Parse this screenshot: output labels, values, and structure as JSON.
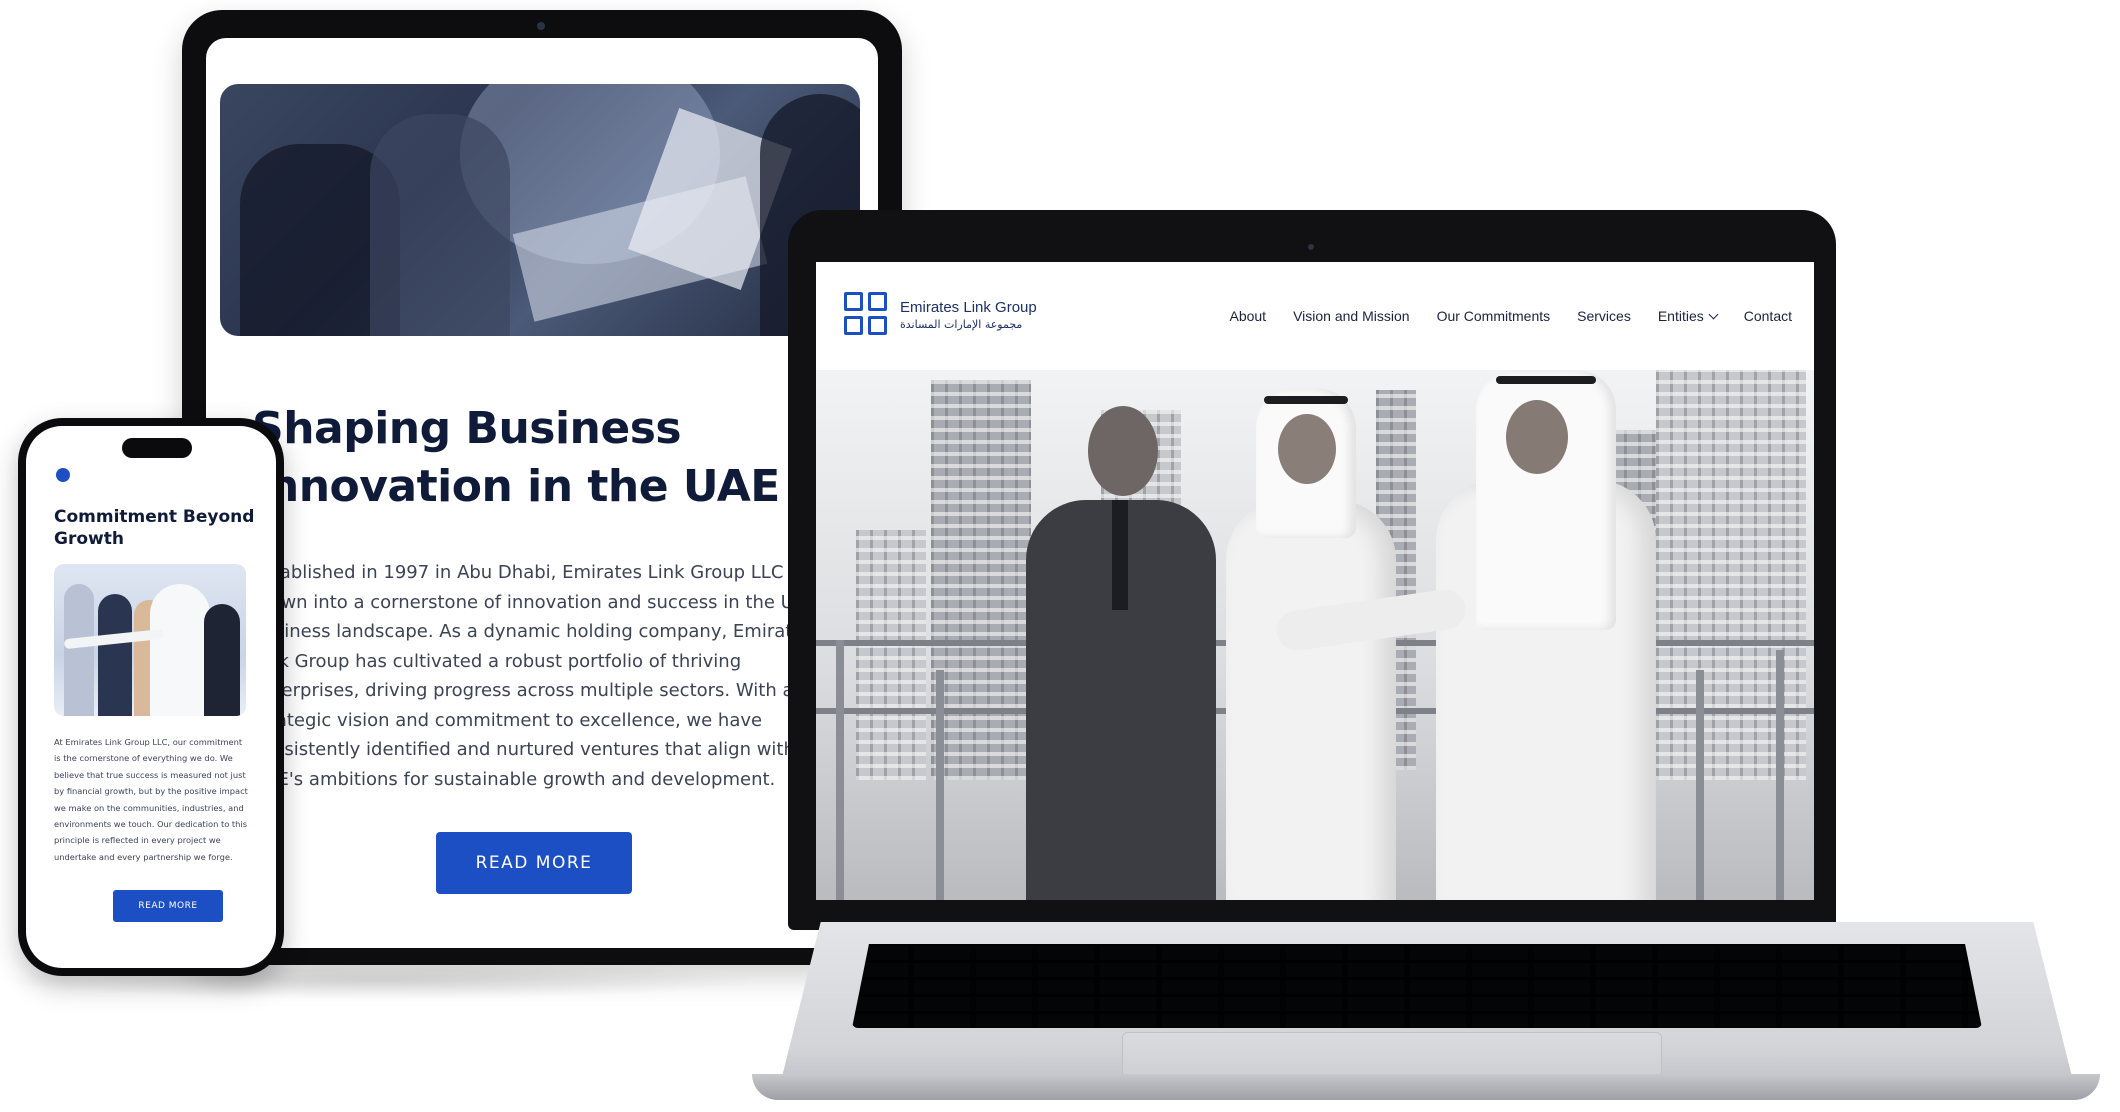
{
  "tablet": {
    "headline": "Shaping Business Innovation in the UAE",
    "body": "Established in 1997 in Abu Dhabi, Emirates Link Group LLC has grown into a cornerstone of innovation and success in the UAE's business landscape. As a dynamic holding company, Emirates Link Group has cultivated a robust portfolio of thriving enterprises, driving progress across multiple sectors. With a strategic vision and commitment to excellence, we have consistently identified and nurtured ventures that align with the UAE's ambitions for sustainable growth and development.",
    "button_label": "READ MORE"
  },
  "phone": {
    "title": "Commitment Beyond Growth",
    "body": "At Emirates Link Group LLC, our commitment is the cornerstone of everything we do. We believe that true success is measured not just by financial growth, but by the positive impact we make on the communities, industries, and environments we touch. Our dedication to this principle is reflected in every project we undertake and every partnership we forge.",
    "button_label": "READ MORE"
  },
  "laptop": {
    "brand_name": "Emirates Link Group",
    "brand_arabic": "مجموعة الإمارات المساندة",
    "nav": [
      {
        "label": "About"
      },
      {
        "label": "Vision and Mission"
      },
      {
        "label": "Our Commitments"
      },
      {
        "label": "Services"
      },
      {
        "label": "Entities",
        "has_dropdown": true,
        "icon": "chevron-down-icon"
      },
      {
        "label": "Contact"
      }
    ]
  },
  "colors": {
    "accent": "#1d4fc4",
    "heading": "#101b3a",
    "body_text": "#3c4354",
    "device_frame": "#0d0d0f"
  }
}
